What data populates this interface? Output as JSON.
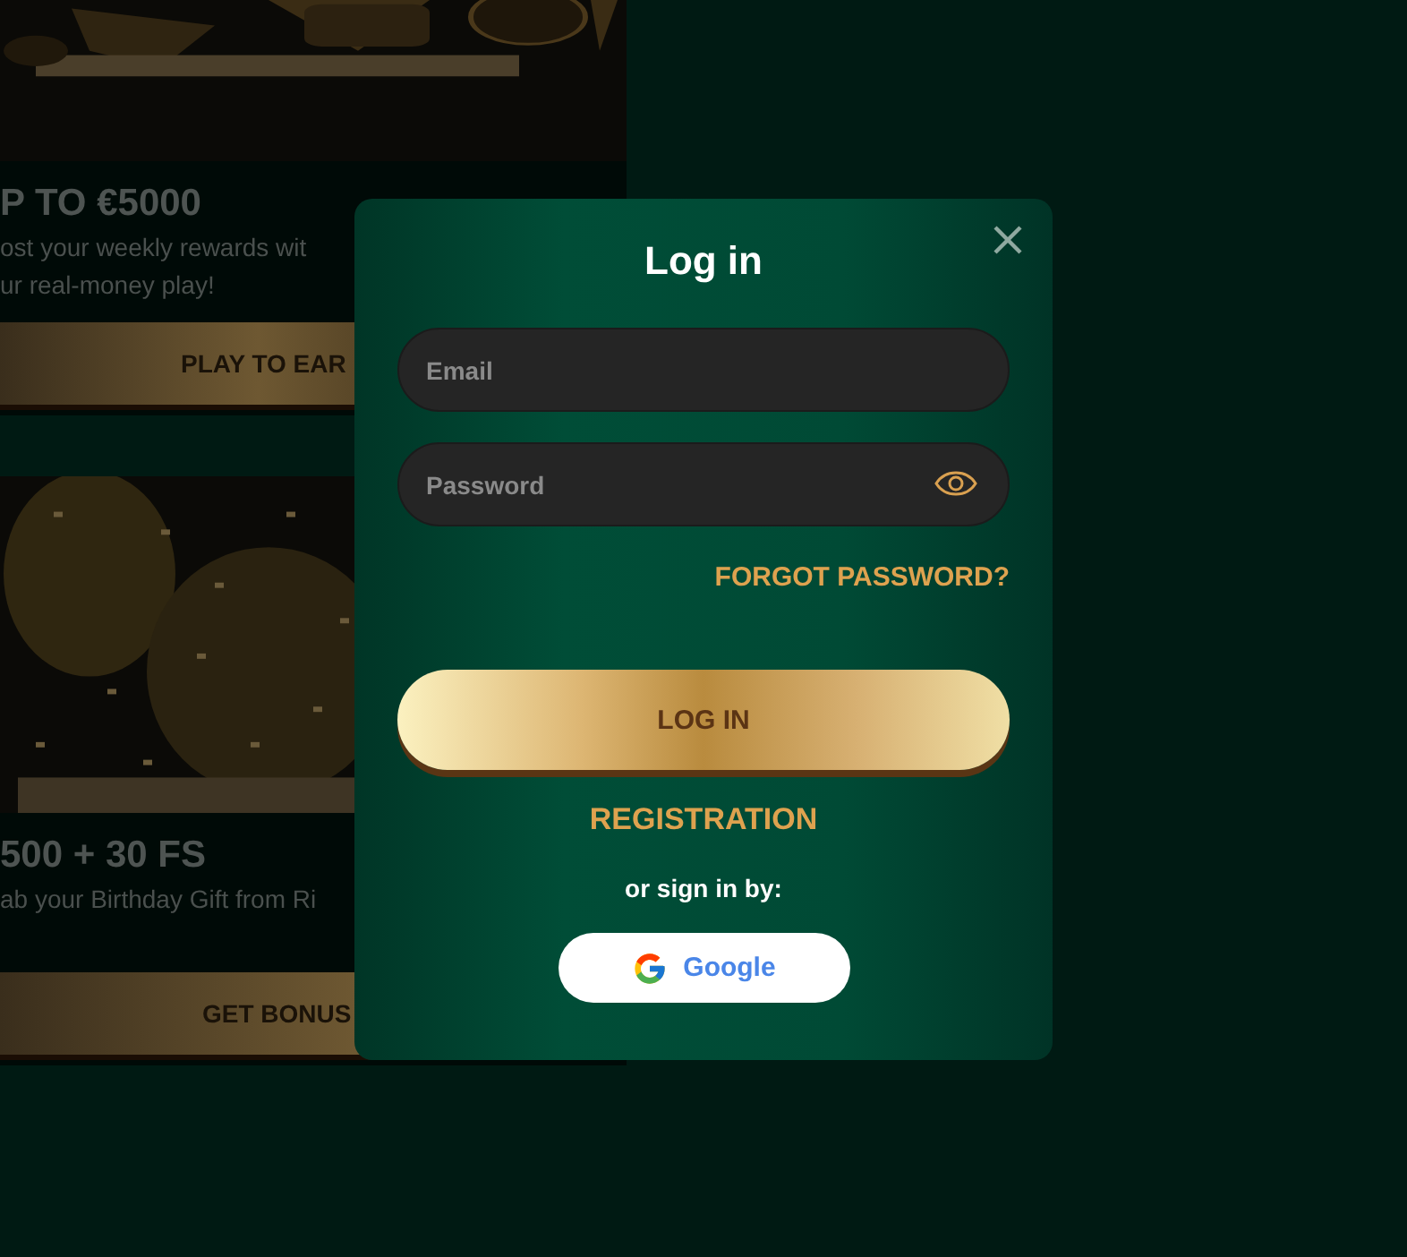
{
  "promo_cards": [
    {
      "title": "P TO €5000",
      "description": [
        "ost your weekly rewards wit",
        "ur real-money play!"
      ],
      "button": "PLAY TO EAR"
    },
    {
      "title": "500 + 30 FS",
      "description": [
        "ab your Birthday Gift from Ri"
      ],
      "button": "GET BONUS"
    }
  ],
  "login_dialog": {
    "title": "Log in",
    "fields": [
      {
        "kind": "email",
        "placeholder": "Email"
      },
      {
        "kind": "password",
        "placeholder": "Password"
      }
    ],
    "forgot_link": "FORGOT PASSWORD?",
    "submit_button": "LOG IN",
    "registration_link": "REGISTRATION",
    "alt_signin_label": "or sign in by:",
    "social_buttons": [
      {
        "kind": "google",
        "label": "Google"
      }
    ]
  }
}
